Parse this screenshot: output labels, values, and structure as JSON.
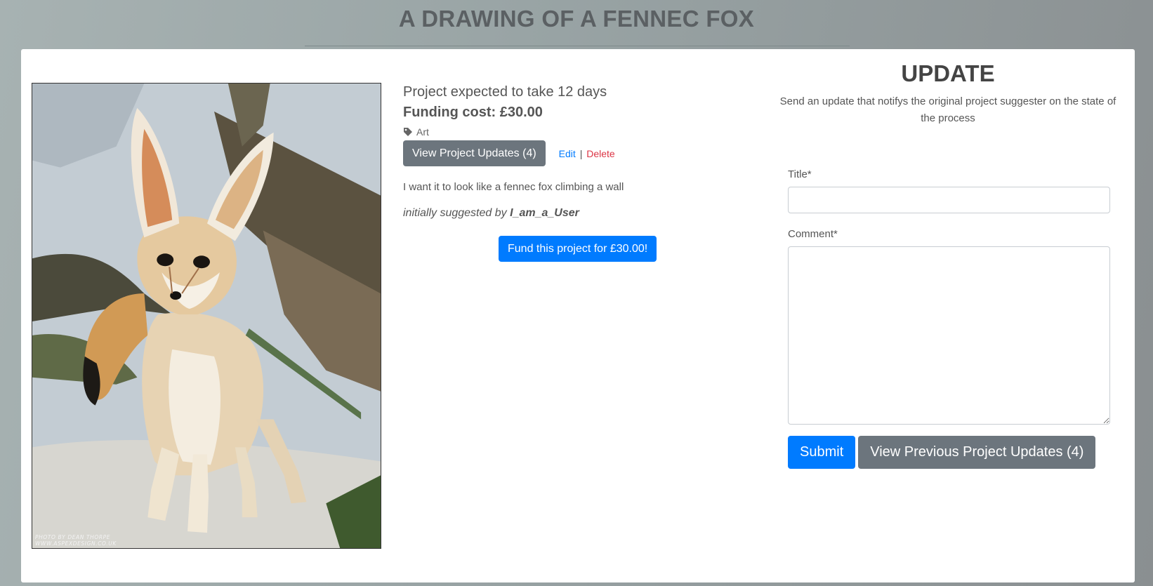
{
  "page": {
    "title": "A DRAWING OF A FENNEC FOX"
  },
  "photo": {
    "alt": "Fennec fox photo",
    "credit_line1": "PHOTO BY DEAN THORPE",
    "credit_line2": "WWW.ASPEXDESIGN.CO.UK"
  },
  "project": {
    "duration": "Project expected to take 12 days",
    "funding_cost": "Funding cost: £30.00",
    "tag": "Art",
    "view_updates_label": "View Project Updates (4)",
    "edit_label": "Edit",
    "separator": "|",
    "delete_label": "Delete",
    "description": "I want it to look like a fennec fox climbing a wall",
    "suggested_prefix": "initially suggested by",
    "suggested_user": "I_am_a_User",
    "fund_label": "Fund this project for £30.00!"
  },
  "update": {
    "heading": "UPDATE",
    "description": "Send an update that notifys the original project suggester on the state of the process",
    "title_label": "Title*",
    "title_value": "",
    "comment_label": "Comment*",
    "comment_value": "",
    "submit_label": "Submit",
    "previous_label": "View Previous Project Updates (4)"
  },
  "colors": {
    "primary": "#007bff",
    "secondary": "#6c757d",
    "danger": "#dc3545"
  }
}
